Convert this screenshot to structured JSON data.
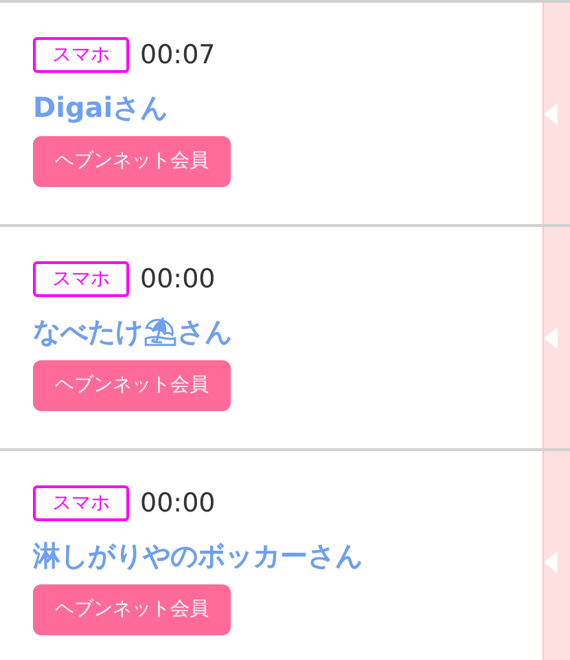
{
  "messages": [
    {
      "device": "スマホ",
      "time": "00:07",
      "name": "Digaiさん",
      "member_button": "ヘブンネット会員"
    },
    {
      "device": "スマホ",
      "time": "00:00",
      "name": "なべたけ⛱さん",
      "member_button": "ヘブンネット会員"
    },
    {
      "device": "スマホ",
      "time": "00:00",
      "name": "淋しがりやのボッカーさん",
      "member_button": "ヘブンネット会員"
    }
  ]
}
